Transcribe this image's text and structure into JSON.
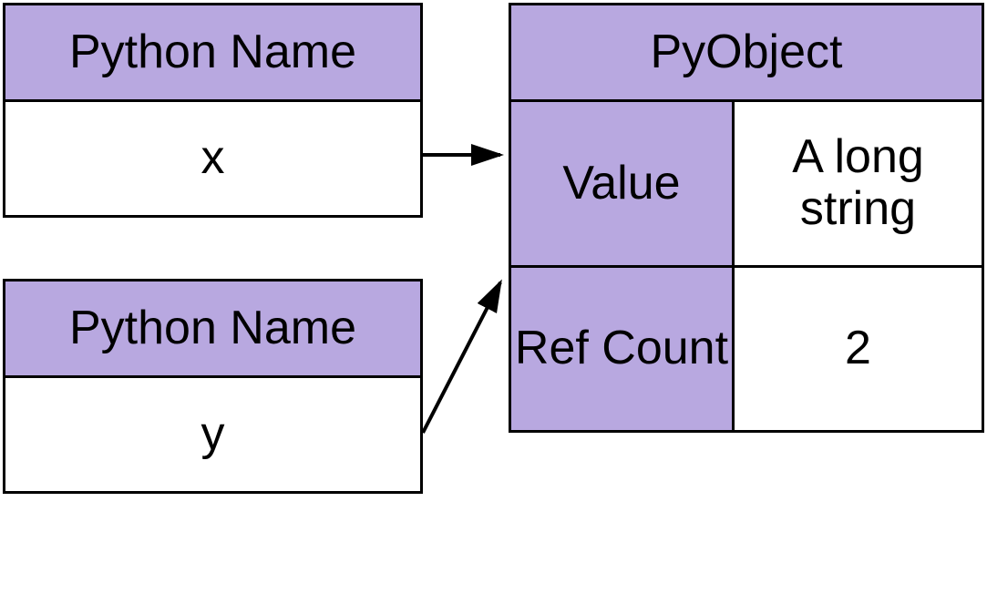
{
  "name_box_1": {
    "header": "Python Name",
    "value": "x"
  },
  "name_box_2": {
    "header": "Python Name",
    "value": "y"
  },
  "pyobject": {
    "header": "PyObject",
    "row1_label": "Value",
    "row1_value": "A long string",
    "row2_label": "Ref Count",
    "row2_value": "2"
  }
}
